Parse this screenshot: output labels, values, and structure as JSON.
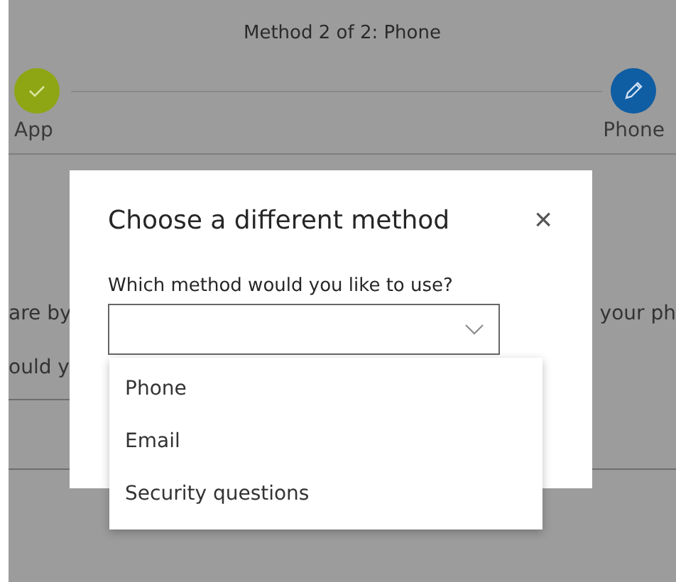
{
  "page": {
    "heading": "Method 2 of 2: Phone",
    "steps": [
      {
        "label": "App",
        "kind": "done"
      },
      {
        "label": "Phone",
        "kind": "current"
      }
    ],
    "text_fragments": [
      "are by",
      "your ph",
      "ould y"
    ]
  },
  "dialog": {
    "title": "Choose a different method",
    "close": "×",
    "question": "Which method would you like to use?",
    "select": {
      "expanded": true,
      "options": [
        {
          "label": "Phone"
        },
        {
          "label": "Email"
        },
        {
          "label": "Security questions"
        }
      ]
    }
  }
}
